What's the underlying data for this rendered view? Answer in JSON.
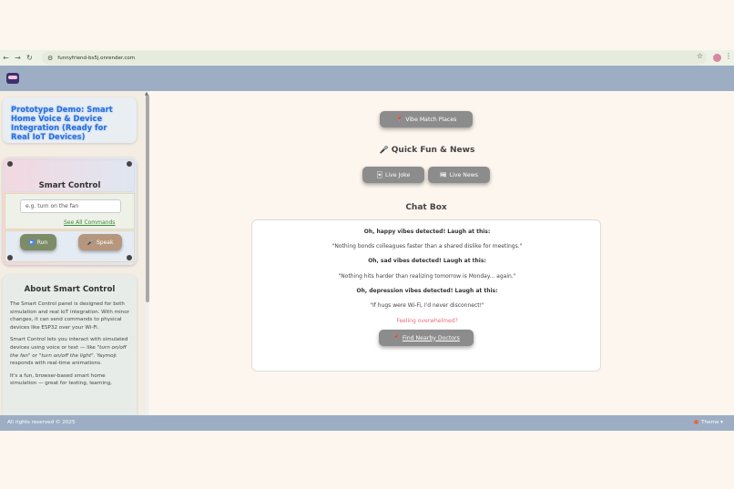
{
  "browser": {
    "url": "funnyfriend-bs5j.onrender.com"
  },
  "sidebar": {
    "title": "Prototype Demo: Smart Home Voice & Device Integration (Ready for Real IoT Devices)",
    "smart_control": {
      "title": "Smart Control",
      "input_placeholder": "e.g. turn on the fan",
      "see_all_label": "See All Commands",
      "run_label": "Run",
      "speak_label": "Speak"
    },
    "about": {
      "title": "About Smart Control",
      "p1": "The Smart Control panel is designed for both simulation and real IoT integration. With minor changes, it can send commands to physical devices like ESP32 over your Wi-Fi.",
      "p2_a": "Smart Control lets you interact with simulated devices using voice or text — like ",
      "p2_em1": "\"turn on/off the fan\"",
      "p2_b": " or ",
      "p2_em2": "\"turn on/off the light\"",
      "p2_c": ". Yaymoji responds with real-time animations.",
      "p3": "It's a fun, browser-based smart home simulation — great for testing, learning,"
    }
  },
  "main": {
    "vibe_match_label": "Vibe Match Places",
    "quick_fun_title": "Quick Fun & News",
    "live_joke_label": "Live Joke",
    "live_news_label": "Live News",
    "chat_box_title": "Chat Box",
    "chat": {
      "line1": "Oh, happy vibes detected! Laugh at this:",
      "line2": "\"Nothing bonds colleagues faster than a shared dislike for meetings.\"",
      "line3": "Oh, sad vibes detected! Laugh at this:",
      "line4": "\"Nothing hits harder than realizing tomorrow is Monday... again.\"",
      "line5": "Oh, depression vibes detected! Laugh at this:",
      "line6": "\"If hugs were Wi-Fi, I'd never disconnect!\"",
      "line7": "Feeling overwhelmed?"
    },
    "find_doctors_label": "Find Nearby Doctors"
  },
  "footer": {
    "rights": "All rights reserved © 2025",
    "theme_label": "Theme"
  },
  "colors": {
    "appbar": "#9daec4",
    "title_blue": "#2a6fd6",
    "alert_red": "#e96b7a",
    "pill_gray": "#8c8c8c"
  }
}
